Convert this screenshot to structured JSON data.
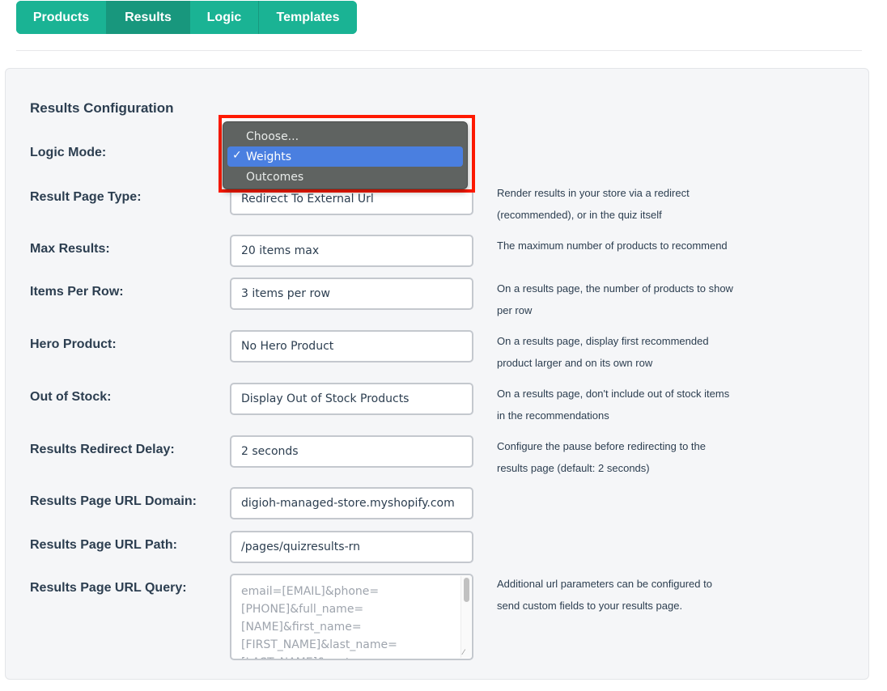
{
  "tabs": [
    {
      "label": "Products",
      "active": false
    },
    {
      "label": "Results",
      "active": true
    },
    {
      "label": "Logic",
      "active": false
    },
    {
      "label": "Templates",
      "active": false
    }
  ],
  "panel": {
    "title": "Results Configuration"
  },
  "fields": {
    "logic_mode": {
      "label": "Logic Mode:",
      "value": "Weights"
    },
    "result_page_type": {
      "label": "Result Page Type:",
      "value": "Redirect To External Url",
      "help": [
        "Render results in your store via a redirect",
        "(recommended), or in the quiz itself"
      ]
    },
    "max_results": {
      "label": "Max Results:",
      "value": "20 items max",
      "help": [
        "The maximum number of products to recommend"
      ]
    },
    "items_per_row": {
      "label": "Items Per Row:",
      "value": "3 items per row",
      "help": [
        "On a results page, the number of products to show",
        "per row"
      ]
    },
    "hero_product": {
      "label": "Hero Product:",
      "value": "No Hero Product",
      "help": [
        "On a results page, display first recommended",
        "product larger and on its own row"
      ]
    },
    "out_of_stock": {
      "label": "Out of Stock:",
      "value": "Display Out of Stock Products",
      "help": [
        "On a results page, don't include out of stock items",
        "in the recommendations"
      ]
    },
    "redirect_delay": {
      "label": "Results Redirect Delay:",
      "value": "2 seconds",
      "help": [
        "Configure the pause before redirecting to the",
        "results page (default: 2 seconds)"
      ]
    },
    "url_domain": {
      "label": "Results Page URL Domain:",
      "value": "digioh-managed-store.myshopify.com"
    },
    "url_path": {
      "label": "Results Page URL Path:",
      "value": "/pages/quizresults-rn"
    },
    "url_query": {
      "label": "Results Page URL Query:",
      "placeholder_lines": [
        "email=[EMAIL]&phone=",
        "[PHONE]&full_name=",
        "[NAME]&first_name=",
        "[FIRST_NAME]&last_name=",
        "[LAST_NAME]&customer..."
      ],
      "help": [
        "Additional url parameters can be configured to",
        "send custom fields to your results page."
      ]
    }
  },
  "dropdown": {
    "options": [
      {
        "label": "Choose...",
        "selected": false
      },
      {
        "label": "Weights",
        "selected": true
      },
      {
        "label": "Outcomes",
        "selected": false
      }
    ],
    "check_glyph": "✓",
    "highlight_color": "#ff1a00"
  },
  "colors": {
    "brand": "#1ab394",
    "brand_active": "#18977d",
    "selected_option": "#4a7fe0"
  }
}
